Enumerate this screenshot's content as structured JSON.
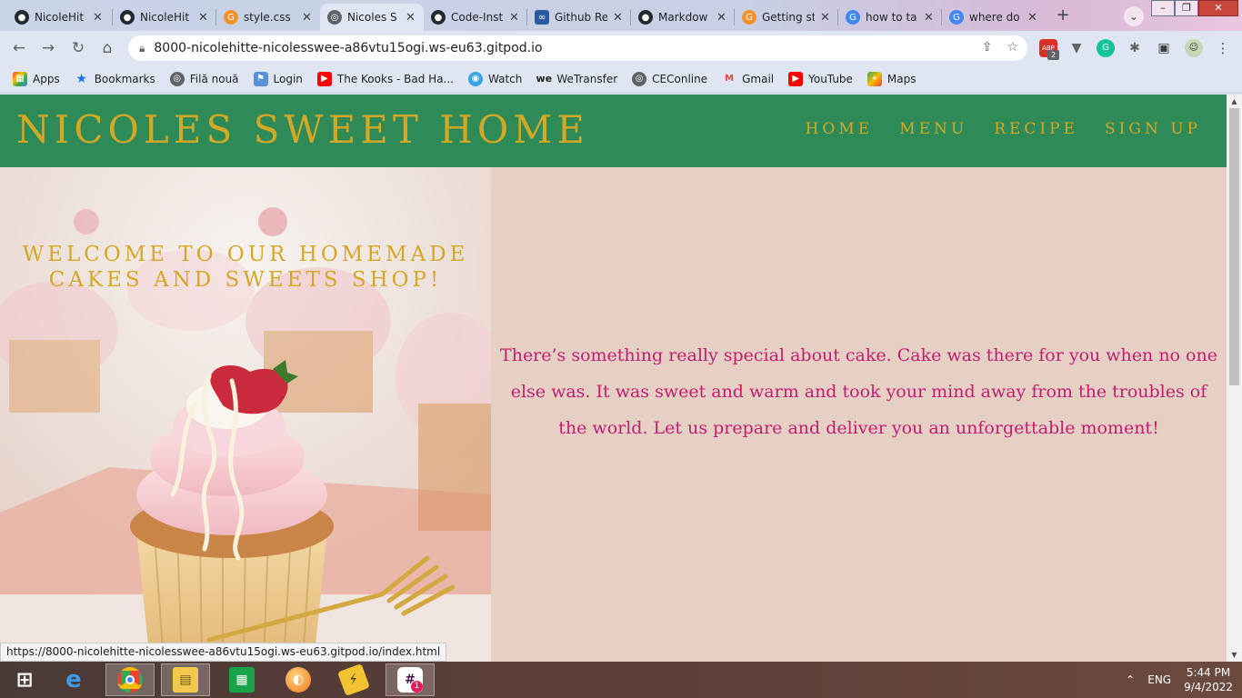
{
  "browser": {
    "tabs": [
      {
        "title": "NicoleHit",
        "favicon": "github-icon",
        "active": false
      },
      {
        "title": "NicoleHit",
        "favicon": "github-icon",
        "active": false
      },
      {
        "title": "style.css",
        "favicon": "gitpod-icon",
        "active": false
      },
      {
        "title": "Nicoles S",
        "favicon": "globe-icon",
        "active": true
      },
      {
        "title": "Code-Inst",
        "favicon": "github-icon",
        "active": false
      },
      {
        "title": "Github Re",
        "favicon": "infinity-icon",
        "active": false
      },
      {
        "title": "Markdow",
        "favicon": "github-icon",
        "active": false
      },
      {
        "title": "Getting st",
        "favicon": "gitpod-icon",
        "active": false
      },
      {
        "title": "how to ta",
        "favicon": "google-icon",
        "active": false
      },
      {
        "title": "where do",
        "favicon": "google-icon",
        "active": false
      }
    ],
    "url": "8000-nicolehitte-nicolesswee-a86vtu15ogi.ws-eu63.gitpod.io",
    "extension_badge": "2",
    "extension_label": "ABP",
    "bookmarks": [
      {
        "label": "Apps",
        "icon": "apps-grid-icon"
      },
      {
        "label": "Bookmarks",
        "icon": "star-icon"
      },
      {
        "label": "Filă nouă",
        "icon": "globe-icon"
      },
      {
        "label": "Login",
        "icon": "login-icon"
      },
      {
        "label": "The Kooks - Bad Ha...",
        "icon": "youtube-icon"
      },
      {
        "label": "Watch",
        "icon": "watch-icon"
      },
      {
        "label": "WeTransfer",
        "icon": "wetransfer-icon"
      },
      {
        "label": "CEConline",
        "icon": "globe-icon"
      },
      {
        "label": "Gmail",
        "icon": "gmail-icon"
      },
      {
        "label": "YouTube",
        "icon": "youtube-icon"
      },
      {
        "label": "Maps",
        "icon": "maps-icon"
      }
    ],
    "status_url": "https://8000-nicolehitte-nicolesswee-a86vtu15ogi.ws-eu63.gitpod.io/index.html"
  },
  "site": {
    "logo": "NICOLES SWEET HOME",
    "nav": [
      "HOME",
      "MENU",
      "RECIPE",
      "SIGN UP"
    ],
    "hero_title": "WELCOME TO OUR HOMEMADE CAKES AND SWEETS SHOP!",
    "tagline": "There’s something really special about cake. Cake was there for you when no one else was. It was sweet and warm and took your mind away from the troubles of the world. Let us prepare and deliver you an unforgettable moment!",
    "colors": {
      "header_bg": "#2e8b57",
      "gold": "#d4a827",
      "content_bg": "#e6d0c4",
      "tagline": "#c41b73"
    }
  },
  "taskbar": {
    "language": "ENG",
    "time": "5:44 PM",
    "date": "9/4/2022",
    "apps": [
      "windows-start-icon",
      "internet-explorer-icon",
      "chrome-icon",
      "file-explorer-icon",
      "store-icon",
      "media-player-icon",
      "app-icon",
      "slack-icon"
    ],
    "slack_badge": "1"
  }
}
